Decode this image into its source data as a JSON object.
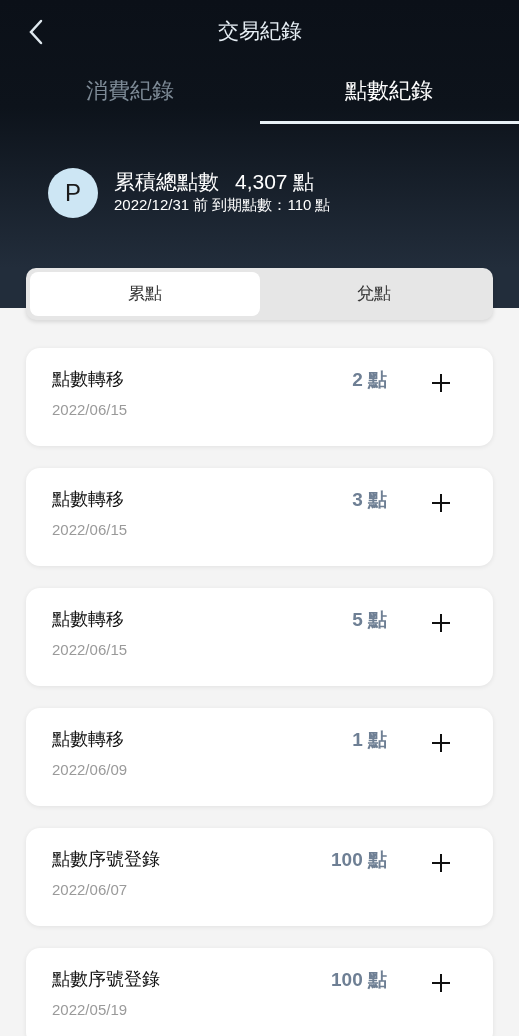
{
  "header": {
    "title": "交易紀錄"
  },
  "tabs": [
    {
      "label": "消費紀錄",
      "selected": false
    },
    {
      "label": "點數紀錄",
      "selected": true
    }
  ],
  "summary": {
    "badge": "P",
    "total_label": "累積總點數",
    "total_value": "4,307 點",
    "expiry": "2022/12/31 前 到期點數：110 點"
  },
  "segments": [
    {
      "label": "累點",
      "selected": true
    },
    {
      "label": "兌點",
      "selected": false
    }
  ],
  "records": [
    {
      "title": "點數轉移",
      "date": "2022/06/15",
      "points": "2 點",
      "expanded": false
    },
    {
      "title": "點數轉移",
      "date": "2022/06/15",
      "points": "3 點",
      "expanded": false
    },
    {
      "title": "點數轉移",
      "date": "2022/06/15",
      "points": "5 點",
      "expanded": false
    },
    {
      "title": "點數轉移",
      "date": "2022/06/09",
      "points": "1 點",
      "expanded": false
    },
    {
      "title": "點數序號登錄",
      "date": "2022/06/07",
      "points": "100 點",
      "expanded": false
    },
    {
      "title": "點數序號登錄",
      "date": "2022/05/19",
      "points": "100 點",
      "expanded": false
    }
  ]
}
